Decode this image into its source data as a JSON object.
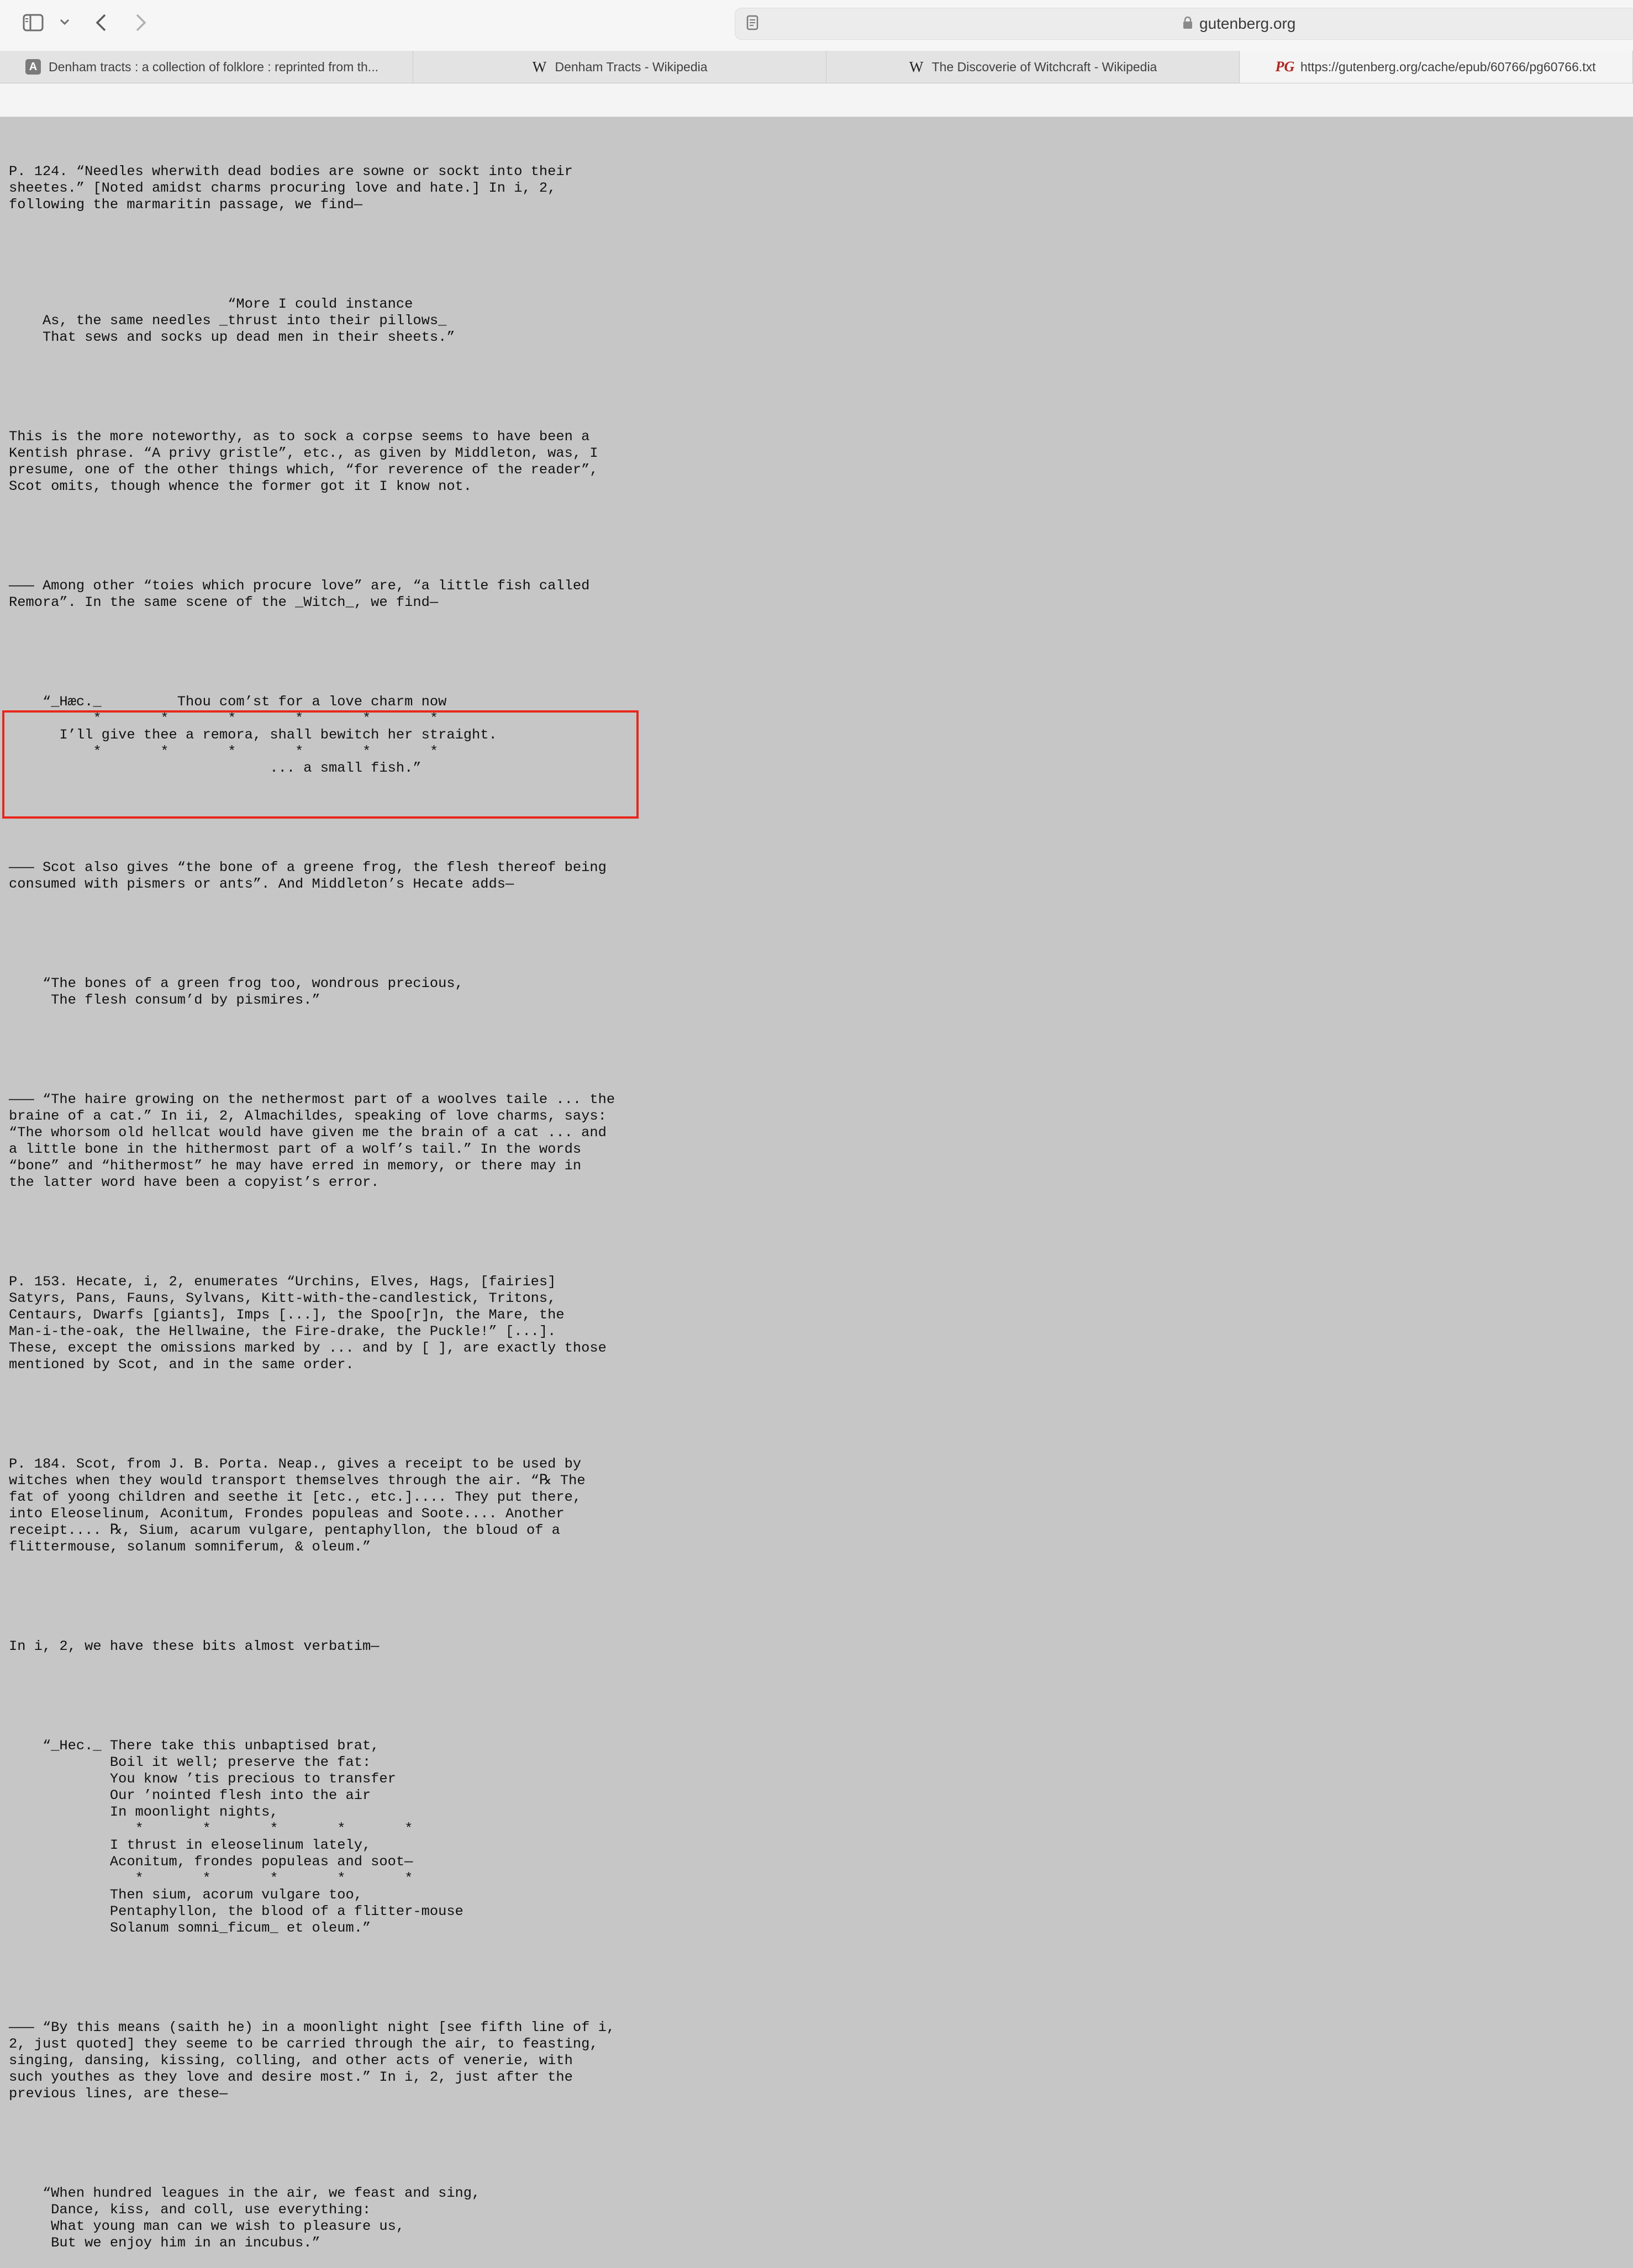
{
  "toolbar": {
    "url": "gutenberg.org",
    "icons": [
      "sidebar-icon",
      "chevron-down-icon",
      "back-icon",
      "forward-icon",
      "reader-icon",
      "lock-icon"
    ]
  },
  "tabs": [
    {
      "label": "Denham tracts : a collection of folklore : reprinted from th...",
      "favicon": "A",
      "active": false
    },
    {
      "label": "Denham Tracts - Wikipedia",
      "favicon": "W",
      "active": false
    },
    {
      "label": "The Discoverie of Witchcraft - Wikipedia",
      "favicon": "W",
      "active": false
    },
    {
      "label": "https://gutenberg.org/cache/epub/60766/pg60766.txt",
      "favicon": "PG",
      "active": true
    }
  ],
  "colors": {
    "highlight": "#e8261c",
    "page_bg": "#c6c6c6"
  },
  "document": {
    "p124": "P. 124. “Needles wherwith dead bodies are sowne or sockt into their\nsheetes.” [Noted amidst charms procuring love and hate.] In i, 2,\nfollowing the marmaritin passage, we find—",
    "quote1": "                          “More I could instance\n    As, the same needles _thrust into their pillows_\n    That sews and socks up dead men in their sheets.”",
    "p_noteworthy": "This is the more noteworthy, as to sock a corpse seems to have been a\nKentish phrase. “A privy gristle”, etc., as given by Middleton, was, I\npresume, one of the other things which, “for reverence of the reader”,\nScot omits, though whence the former got it I know not.",
    "p_remora": "——— Among other “toies which procure love” are, “a little fish called\nRemora”. In the same scene of the _Witch_, we find—",
    "quote2": "    “_Hæc._         Thou com’st for a love charm now\n          *       *       *       *       *       *\n      I’ll give thee a remora, shall bewitch her straight.\n          *       *       *       *       *       *\n                               ... a small fish.”",
    "p_frog": "——— Scot also gives “the bone of a greene frog, the flesh thereof being\nconsumed with pismers or ants”. And Middleton’s Hecate adds—",
    "quote3": "    “The bones of a green frog too, wondrous precious,\n     The flesh consum’d by pismires.”",
    "p_haire": "——— “The haire growing on the nethermost part of a woolves taile ... the\nbraine of a cat.” In ii, 2, Almachildes, speaking of love charms, says:\n“The whorsom old hellcat would have given me the brain of a cat ... and\na little bone in the hithermost part of a wolf’s tail.” In the words\n“bone” and “hithermost” he may have erred in memory, or there may in\nthe latter word have been a copyist’s error.",
    "p153": "P. 153. Hecate, i, 2, enumerates “Urchins, Elves, Hags, [fairies]\nSatyrs, Pans, Fauns, Sylvans, Kitt-with-the-candlestick, Tritons,\nCentaurs, Dwarfs [giants], Imps [...], the Spoo[r]n, the Mare, the\nMan-i-the-oak, the Hellwaine, the Fire-drake, the Puckle!” [...].\nThese, except the omissions marked by ... and by [ ], are exactly those\nmentioned by Scot, and in the same order.",
    "p184": "P. 184. Scot, from J. B. Porta. Neap., gives a receipt to be used by\nwitches when they would transport themselves through the air. “℞ The\nfat of yoong children and seethe it [etc., etc.].... They put there,\ninto Eleoselinum, Aconitum, Frondes populeas and Soote.... Another\nreceipt.... ℞, Sium, acarum vulgare, pentaphyllon, the bloud of a\nflittermouse, solanum somniferum, & oleum.”",
    "p_verbatim": "In i, 2, we have these bits almost verbatim—",
    "quote4": "    “_Hec._ There take this unbaptised brat,\n            Boil it well; preserve the fat:\n            You know ’tis precious to transfer\n            Our ’nointed flesh into the air\n            In moonlight nights,\n               *       *       *       *       *\n            I thrust in eleoselinum lately,\n            Aconitum, frondes populeas and soot—\n               *       *       *       *       *\n            Then sium, acorum vulgare too,\n            Pentaphyllon, the blood of a flitter-mouse\n            Solanum somni_ficum_ et oleum.”",
    "p_means": "——— “By this means (saith he) in a moonlight night [see fifth line of i,\n2, just quoted] they seeme to be carried through the air, to feasting,\nsinging, dansing, kissing, colling, and other acts of venerie, with\nsuch youthes as they love and desire most.” In i, 2, just after the\nprevious lines, are these—",
    "quote5": "    “When hundred leagues in the air, we feast and sing,\n     Dance, kiss, and coll, use everything:\n     What young man can we wish to pleasure us,\n     But we enjoy him in an incubus.”"
  }
}
